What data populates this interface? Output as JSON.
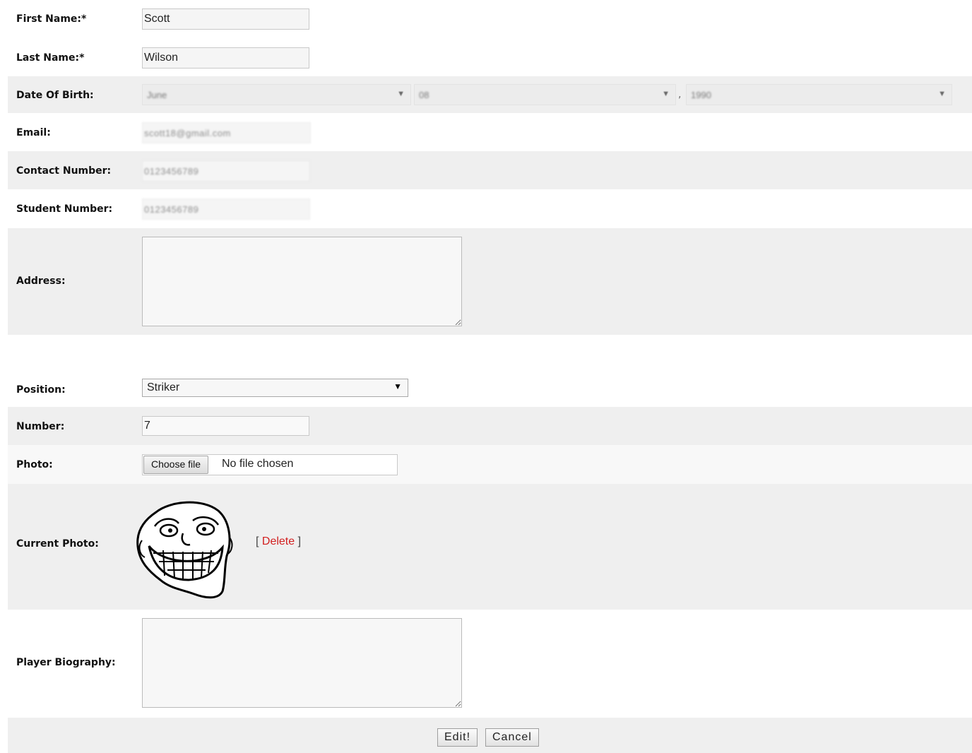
{
  "form": {
    "first_name": {
      "label": "First Name:*",
      "value": "Scott"
    },
    "last_name": {
      "label": "Last Name:*",
      "value": "Wilson"
    },
    "dob": {
      "label": "Date Of Birth:",
      "month": "June",
      "day": "08",
      "separator": ",",
      "year": "1990"
    },
    "email": {
      "label": "Email:",
      "value": "scott18@gmail.com"
    },
    "contact_number": {
      "label": "Contact Number:",
      "value": "0123456789"
    },
    "student_number": {
      "label": "Student Number:",
      "value": "0123456789"
    },
    "address": {
      "label": "Address:",
      "value": ""
    },
    "position": {
      "label": "Position:",
      "value": "Striker"
    },
    "number": {
      "label": "Number:",
      "value": "7"
    },
    "photo": {
      "label": "Photo:",
      "button": "Choose file",
      "status": "No file chosen"
    },
    "current_photo": {
      "label": "Current Photo:",
      "delete_open": "[ ",
      "delete_label": "Delete",
      "delete_close": " ]"
    },
    "biography": {
      "label": "Player Biography:",
      "value": ""
    },
    "actions": {
      "edit": "Edit!",
      "cancel": "Cancel"
    }
  },
  "icons": {
    "select_arrow": "dropdown-arrow-icon",
    "photo": "troll-face-image"
  }
}
